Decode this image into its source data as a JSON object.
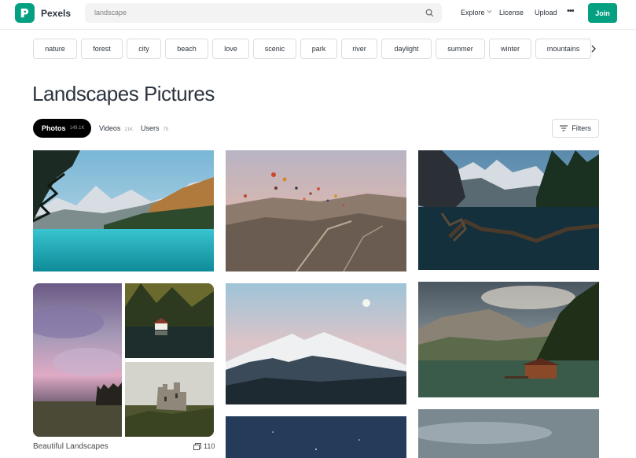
{
  "brand": {
    "name": "Pexels",
    "color": "#05a081"
  },
  "search": {
    "value": "landscape",
    "icon": "search-icon"
  },
  "nav": {
    "explore": "Explore",
    "license": "License",
    "upload": "Upload",
    "more": "•••",
    "join": "Join"
  },
  "chips": [
    "nature",
    "forest",
    "city",
    "beach",
    "love",
    "scenic",
    "park",
    "river",
    "daylight",
    "summer",
    "winter",
    "mountains"
  ],
  "page": {
    "title": "Landscapes Pictures"
  },
  "tabs": [
    {
      "label": "Photos",
      "count": "149.1K"
    },
    {
      "label": "Videos",
      "count": "21K"
    },
    {
      "label": "Users",
      "count": "75"
    }
  ],
  "filters": {
    "label": "Filters"
  },
  "collection": {
    "title": "Beautiful Landscapes",
    "count": "110"
  }
}
